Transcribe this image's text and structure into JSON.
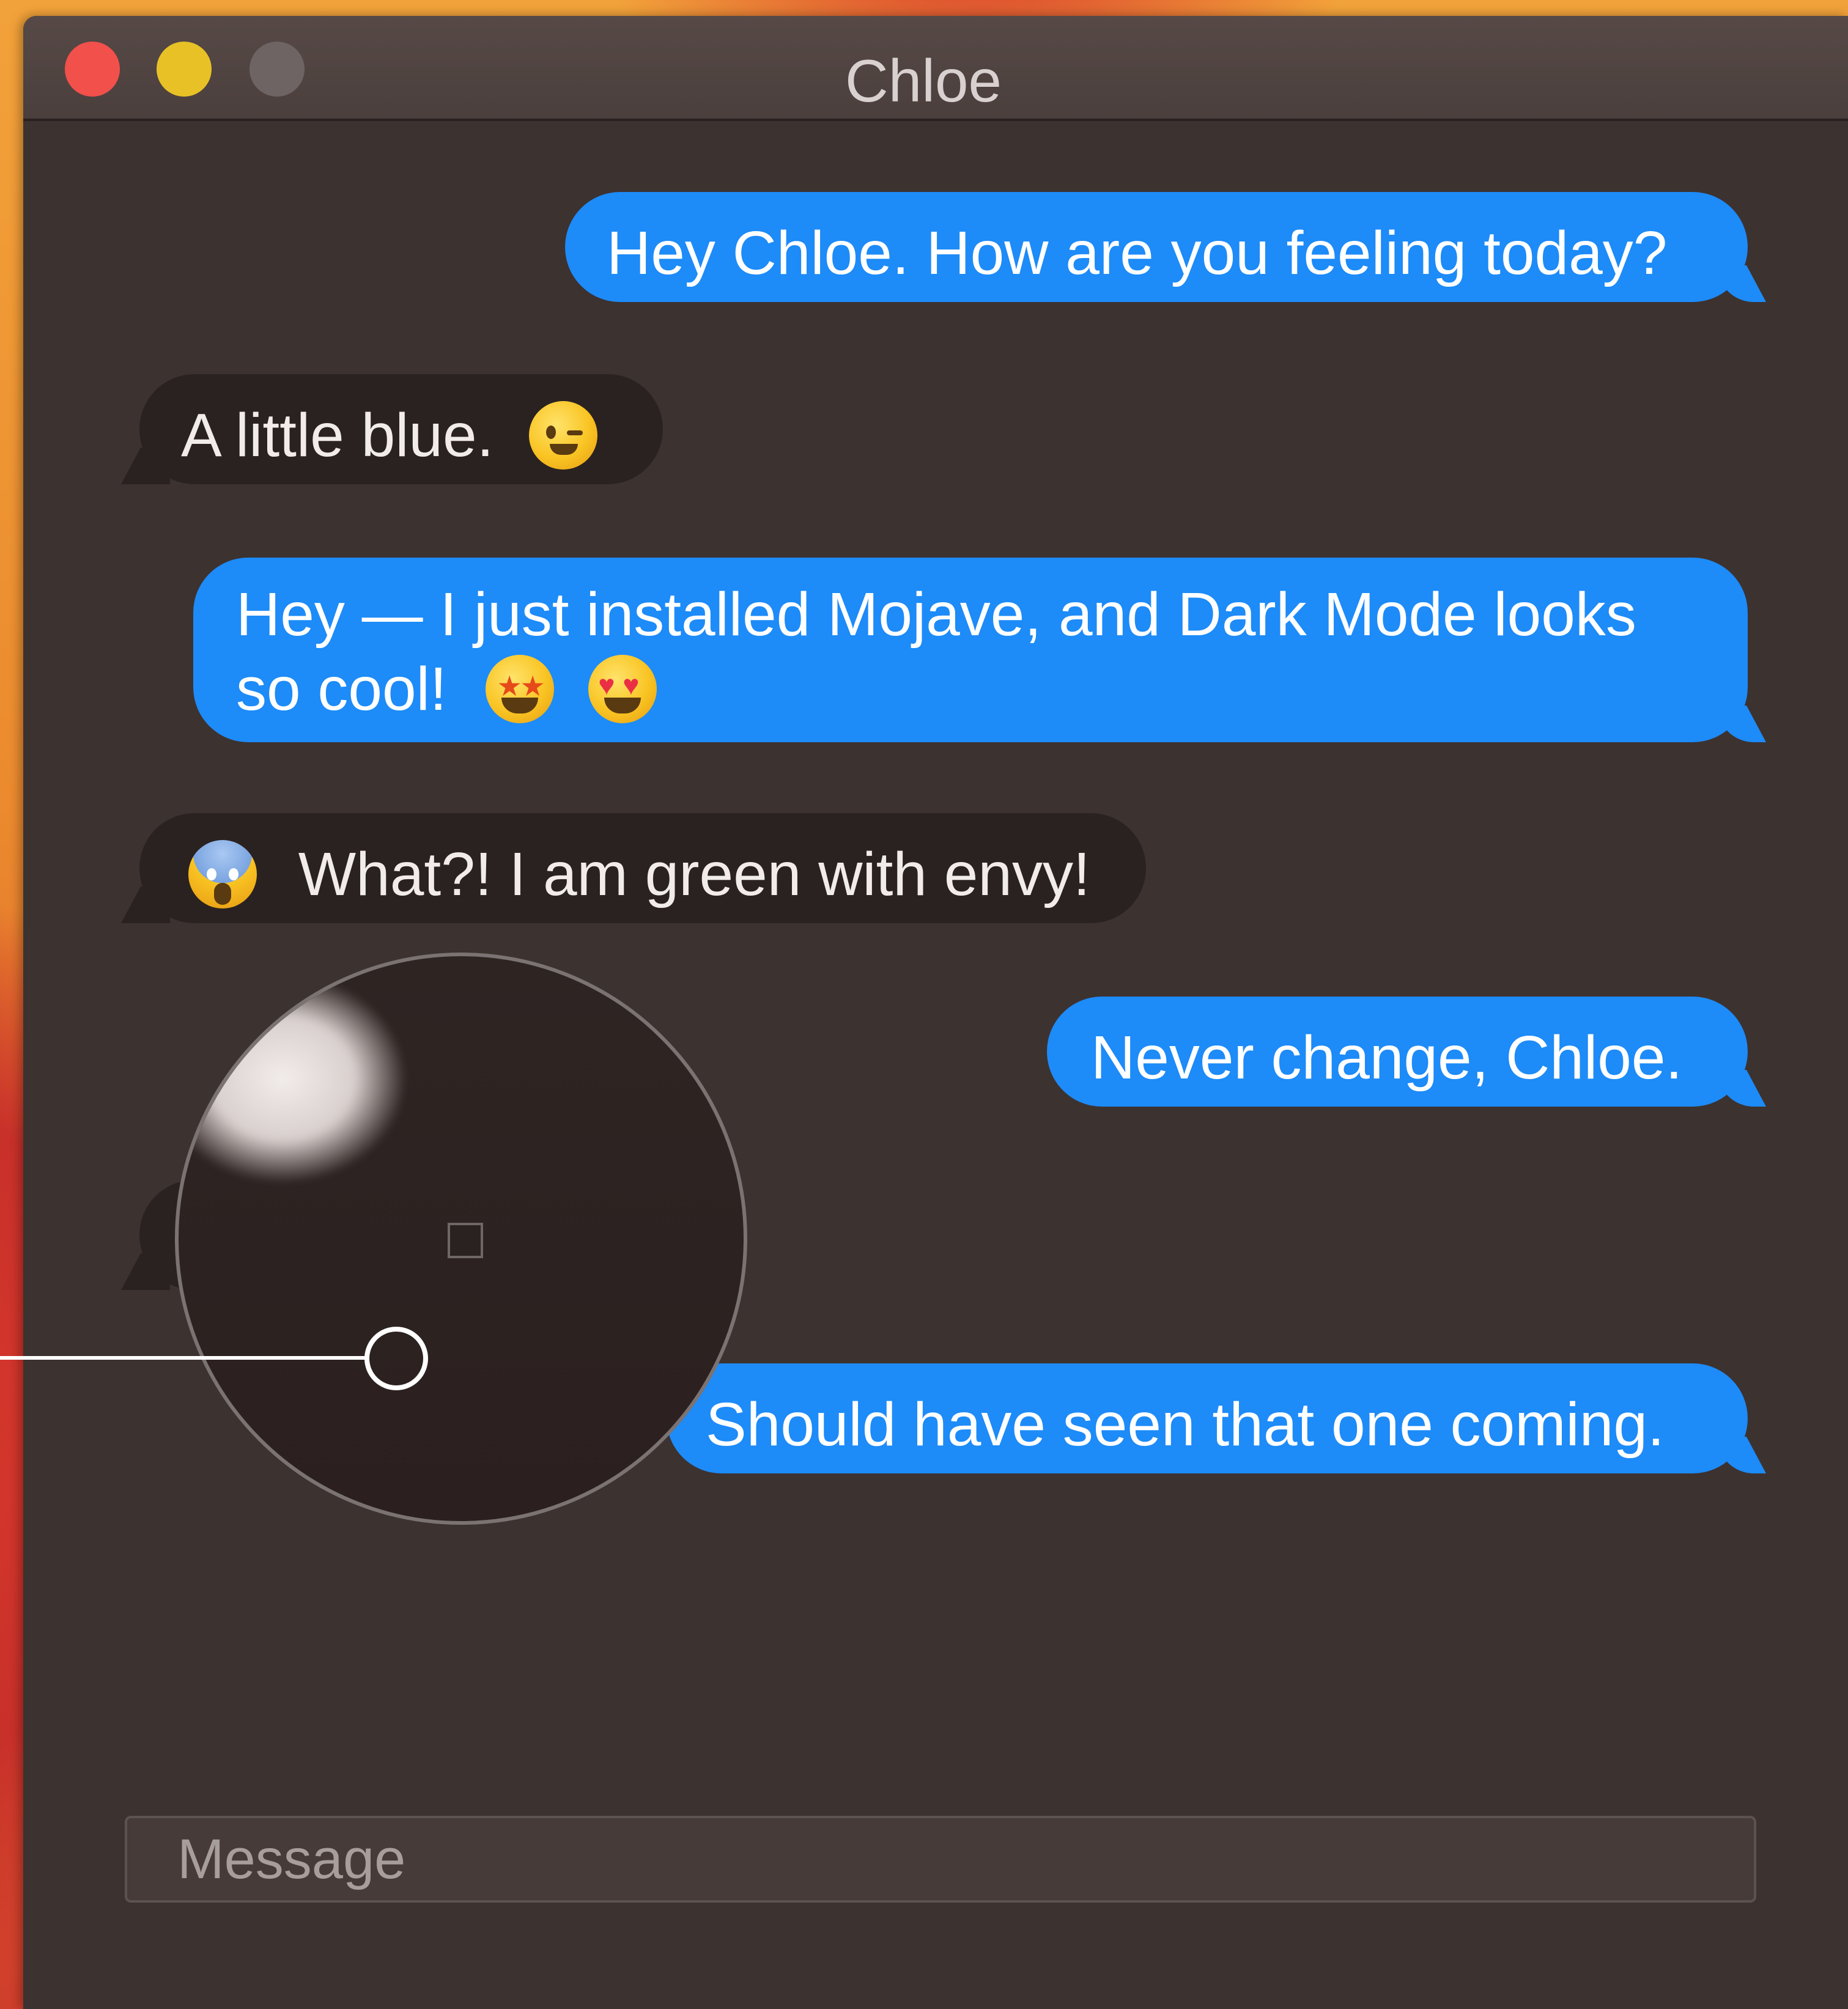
{
  "window": {
    "title": "Chloe"
  },
  "messages": [
    {
      "direction": "sent",
      "text": "Hey Chloe. How are you feeling today?"
    },
    {
      "direction": "received",
      "text": "A little blue.",
      "emoji_after": "winking-face"
    },
    {
      "direction": "sent",
      "text_line1": "Hey — I just installed Mojave, and Dark Mode looks",
      "text_line2": "so cool!",
      "emoji_after": [
        "star-struck-face",
        "heart-eyes-face"
      ]
    },
    {
      "direction": "received",
      "emoji_before": "screaming-face",
      "text": "What?! I am green with envy!"
    },
    {
      "direction": "sent",
      "text": "Never change, Chloe."
    },
    {
      "direction": "sent",
      "text": "Should have seen that one coming."
    }
  ],
  "compose": {
    "placeholder": "Message"
  },
  "colors": {
    "sent_bubble": "#1d8bf8",
    "received_bubble": "#2a2221",
    "window_bg": "#3c3230"
  },
  "tools": {
    "color_picker_magnifier": "visible"
  }
}
